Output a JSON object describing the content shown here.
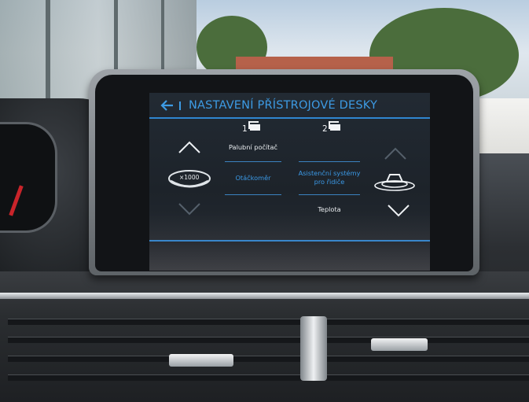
{
  "display": {
    "title": "NASTAVENÍ PŘÍSTROJOVÉ DESKY",
    "back_icon": "arrow-left-icon",
    "accent_color": "#3d9be4",
    "columns": [
      {
        "number": "1",
        "icon": "display-page-icon"
      },
      {
        "number": "2",
        "icon": "display-page-icon"
      }
    ],
    "left_panel": {
      "items": [
        "Palubní počítač",
        "Otáčkoměr"
      ],
      "selected": "Otáčkoměr",
      "gauge_label": "×1000",
      "up_icon": "chevron-up-icon",
      "down_icon": "chevron-down-icon"
    },
    "right_panel": {
      "items": [
        "Asistenční systémy pro řidiče",
        "Teplota"
      ],
      "selected": "Asistenční systémy pro řidiče",
      "icon": "driver-assist-car-icon",
      "up_icon": "chevron-up-icon",
      "down_icon": "chevron-down-icon"
    }
  }
}
